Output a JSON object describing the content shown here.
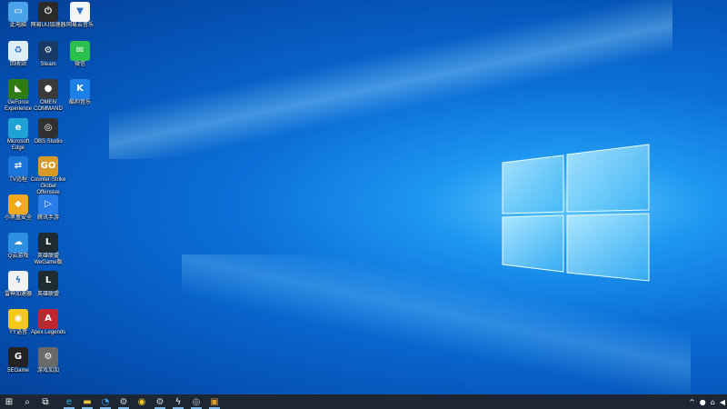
{
  "desktop": {
    "icons": [
      {
        "label": "此电脑",
        "glyph": "▭",
        "bg": "#4aa3e8",
        "icon": "this-pc-icon",
        "col": 0,
        "row": 0
      },
      {
        "label": "回收站",
        "glyph": "♻",
        "bg": "#dfeef8",
        "icon": "recycle-bin-icon",
        "col": 0,
        "row": 1
      },
      {
        "label": "GeForce Experience",
        "glyph": "◣",
        "bg": "#2f7d12",
        "icon": "nvidia-icon",
        "col": 0,
        "row": 2
      },
      {
        "label": "Microsoft Edge",
        "glyph": "e",
        "bg": "#1fa3d6",
        "icon": "edge-icon",
        "col": 0,
        "row": 3
      },
      {
        "label": "TV远程",
        "glyph": "⇄",
        "bg": "#1b75d8",
        "icon": "teamviewer-icon",
        "col": 0,
        "row": 4
      },
      {
        "label": "小黑盒安全",
        "glyph": "◆",
        "bg": "#f0a820",
        "icon": "shield-app-icon",
        "col": 0,
        "row": 5
      },
      {
        "label": "Q云游戏",
        "glyph": "☁",
        "bg": "#2c8fe0",
        "icon": "cloud-game-icon",
        "col": 0,
        "row": 6
      },
      {
        "label": "雷神加速器",
        "glyph": "ϟ",
        "bg": "#f2f2f2",
        "icon": "accelerator-icon",
        "col": 0,
        "row": 7
      },
      {
        "label": "YY语音",
        "glyph": "◉",
        "bg": "#f3c71b",
        "icon": "yy-icon",
        "col": 0,
        "row": 8
      },
      {
        "label": "5EGame",
        "glyph": "G",
        "bg": "#222222",
        "icon": "game-platform-icon",
        "col": 0,
        "row": 9
      },
      {
        "label": "网易UU加速器",
        "glyph": "⏻",
        "bg": "#2a2a2a",
        "icon": "uu-accelerator-icon",
        "col": 1,
        "row": 0
      },
      {
        "label": "Steam",
        "glyph": "⚙",
        "bg": "#173a66",
        "icon": "steam-icon",
        "col": 1,
        "row": 1
      },
      {
        "label": "OMEN COMMAND",
        "glyph": "●",
        "bg": "#3a3a3a",
        "icon": "omen-icon",
        "col": 1,
        "row": 2
      },
      {
        "label": "OBS Studio",
        "glyph": "◎",
        "bg": "#303030",
        "icon": "obs-icon",
        "col": 1,
        "row": 3
      },
      {
        "label": "Counter-Strike Global Offensive",
        "glyph": "GO",
        "bg": "#d89a26",
        "icon": "csgo-icon",
        "col": 1,
        "row": 4
      },
      {
        "label": "腾讯手游",
        "glyph": "▷",
        "bg": "#2a7de8",
        "icon": "mobile-game-icon",
        "col": 1,
        "row": 5
      },
      {
        "label": "英雄联盟WeGame版",
        "glyph": "L",
        "bg": "#1e2b30",
        "icon": "lol-icon",
        "col": 1,
        "row": 6
      },
      {
        "label": "英雄联盟",
        "glyph": "L",
        "bg": "#1e2b30",
        "icon": "lol-client-icon",
        "col": 1,
        "row": 7
      },
      {
        "label": "Apex Legends",
        "glyph": "A",
        "bg": "#c0262d",
        "icon": "apex-icon",
        "col": 1,
        "row": 8
      },
      {
        "label": "游戏加加",
        "glyph": "⚙",
        "bg": "#6a6a6a",
        "icon": "game-tool-icon",
        "col": 1,
        "row": 9
      },
      {
        "label": "网易云音乐",
        "glyph": "▼",
        "bg": "#f5f5f5",
        "icon": "music-icon",
        "col": 2,
        "row": 0
      },
      {
        "label": "微信",
        "glyph": "✉",
        "bg": "#2bbf4d",
        "icon": "wechat-icon",
        "col": 2,
        "row": 1
      },
      {
        "label": "酷狗音乐",
        "glyph": "K",
        "bg": "#1d80e8",
        "icon": "kugou-icon",
        "col": 2,
        "row": 2
      }
    ]
  },
  "taskbar": {
    "items": [
      {
        "name": "start-button",
        "glyph": "⊞",
        "color": "#ffffff"
      },
      {
        "name": "search-button",
        "glyph": "⌕",
        "color": "#ffffff"
      },
      {
        "name": "task-view-button",
        "glyph": "⧉",
        "color": "#ffffff"
      },
      {
        "name": "taskbar-edge",
        "glyph": "e",
        "color": "#31b4f0"
      },
      {
        "name": "taskbar-file-explorer",
        "glyph": "▬",
        "color": "#f3c23c"
      },
      {
        "name": "taskbar-qq-browser",
        "glyph": "◔",
        "color": "#3fa6ff"
      },
      {
        "name": "taskbar-steam",
        "glyph": "⚙",
        "color": "#c7d5e0"
      },
      {
        "name": "taskbar-yy",
        "glyph": "◉",
        "color": "#f3c71b"
      },
      {
        "name": "taskbar-steam-2",
        "glyph": "⚙",
        "color": "#c7d5e0"
      },
      {
        "name": "taskbar-accelerator",
        "glyph": "ϟ",
        "color": "#ffffff"
      },
      {
        "name": "taskbar-obs",
        "glyph": "◎",
        "color": "#cccccc"
      },
      {
        "name": "taskbar-csgo",
        "glyph": "▣",
        "color": "#e0a030"
      }
    ],
    "tray": [
      {
        "name": "show-hidden-icons",
        "glyph": "^"
      },
      {
        "name": "microphone-icon",
        "glyph": "●"
      },
      {
        "name": "network-icon",
        "glyph": "⌂"
      },
      {
        "name": "volume-icon",
        "glyph": "◀"
      }
    ]
  },
  "colors": {
    "accent": "#0a6fd8",
    "taskbar": "#1c2733"
  }
}
